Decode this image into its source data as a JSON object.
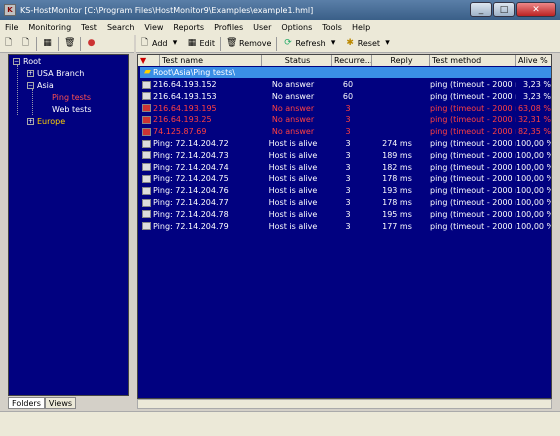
{
  "window": {
    "title": "KS-HostMonitor  [C:\\Program Files\\HostMonitor9\\Examples\\example1.hml]"
  },
  "menu": [
    "File",
    "Monitoring",
    "Test",
    "Search",
    "View",
    "Reports",
    "Profiles",
    "User",
    "Options",
    "Tools",
    "Help"
  ],
  "toolbar": {
    "add": "Add",
    "edit": "Edit",
    "remove": "Remove",
    "refresh": "Refresh",
    "reset": "Reset"
  },
  "tree": {
    "root": "Root",
    "usa": "USA Branch",
    "asia": "Asia",
    "ping": "Ping tests",
    "web": "Web tests",
    "europe": "Europe"
  },
  "tabs": {
    "folders": "Folders",
    "views": "Views"
  },
  "columns": [
    "Test name",
    "Status",
    "Recurre...",
    "Reply",
    "Test method",
    "Alive %"
  ],
  "group": "Root\\Asia\\Ping tests\\",
  "rows": [
    {
      "name": "216.64.193.152",
      "status": "No answer",
      "recurrences": "60",
      "reply": "",
      "method": "ping (timeout - 2000 ms)",
      "alive": "3,23 %",
      "down": false
    },
    {
      "name": "216.64.193.153",
      "status": "No answer",
      "recurrences": "60",
      "reply": "",
      "method": "ping (timeout - 2000 ms)",
      "alive": "3,23 %",
      "down": false
    },
    {
      "name": "216.64.193.195",
      "status": "No answer",
      "recurrences": "3",
      "reply": "",
      "method": "ping (timeout - 2000 ms)",
      "alive": "63,08 %",
      "down": true
    },
    {
      "name": "216.64.193.25",
      "status": "No answer",
      "recurrences": "3",
      "reply": "",
      "method": "ping (timeout - 2000 ms)",
      "alive": "32,31 %",
      "down": true
    },
    {
      "name": "74.125.87.69",
      "status": "No answer",
      "recurrences": "3",
      "reply": "",
      "method": "ping (timeout - 2000 ms)",
      "alive": "82,35 %",
      "down": true
    },
    {
      "name": "Ping: 72.14.204.72",
      "status": "Host is alive",
      "recurrences": "3",
      "reply": "274 ms",
      "method": "ping (timeout - 2000 ms)",
      "alive": "100,00 %",
      "down": false
    },
    {
      "name": "Ping: 72.14.204.73",
      "status": "Host is alive",
      "recurrences": "3",
      "reply": "189 ms",
      "method": "ping (timeout - 2000 ms)",
      "alive": "100,00 %",
      "down": false
    },
    {
      "name": "Ping: 72.14.204.74",
      "status": "Host is alive",
      "recurrences": "3",
      "reply": "182 ms",
      "method": "ping (timeout - 2000 ms)",
      "alive": "100,00 %",
      "down": false
    },
    {
      "name": "Ping: 72.14.204.75",
      "status": "Host is alive",
      "recurrences": "3",
      "reply": "178 ms",
      "method": "ping (timeout - 2000 ms)",
      "alive": "100,00 %",
      "down": false
    },
    {
      "name": "Ping: 72.14.204.76",
      "status": "Host is alive",
      "recurrences": "3",
      "reply": "193 ms",
      "method": "ping (timeout - 2000 ms)",
      "alive": "100,00 %",
      "down": false
    },
    {
      "name": "Ping: 72.14.204.77",
      "status": "Host is alive",
      "recurrences": "3",
      "reply": "178 ms",
      "method": "ping (timeout - 2000 ms)",
      "alive": "100,00 %",
      "down": false
    },
    {
      "name": "Ping: 72.14.204.78",
      "status": "Host is alive",
      "recurrences": "3",
      "reply": "195 ms",
      "method": "ping (timeout - 2000 ms)",
      "alive": "100,00 %",
      "down": false
    },
    {
      "name": "Ping: 72.14.204.79",
      "status": "Host is alive",
      "recurrences": "3",
      "reply": "177 ms",
      "method": "ping (timeout - 2000 ms)",
      "alive": "100,00 %",
      "down": false
    }
  ]
}
